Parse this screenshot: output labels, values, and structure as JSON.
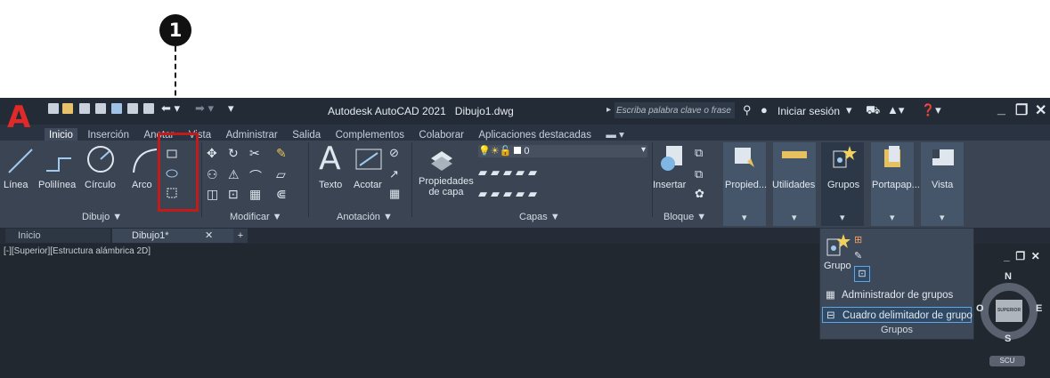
{
  "annotation": {
    "callout_number": "1",
    "highlight_color": "#c21b1b"
  },
  "titlebar": {
    "title": "Autodesk AutoCAD 2021",
    "document": "Dibujo1.dwg",
    "search_placeholder": "Escriba palabra clave o frase",
    "signin": "Iniciar sesión",
    "logo_letter": "A",
    "logo_color": "#e02a2a",
    "icons": [
      "new-icon",
      "open-icon",
      "save-icon",
      "saveas-icon",
      "web-icon",
      "plot-icon",
      "print-icon",
      "undo-icon",
      "redo-icon",
      "search-icon",
      "user-icon",
      "cart-icon",
      "autodesk-icon",
      "help-icon"
    ]
  },
  "ribbon_tabs": [
    "Inicio",
    "Inserción",
    "Anotar",
    "Vista",
    "Administrar",
    "Salida",
    "Complementos",
    "Colaborar",
    "Aplicaciones destacadas"
  ],
  "active_tab": "Inicio",
  "ribbon": {
    "dibujo": {
      "label": "Dibujo ▼",
      "buttons": [
        "Línea",
        "Polilínea",
        "Círculo",
        "Arco"
      ]
    },
    "modificar": {
      "label": "Modificar ▼"
    },
    "anotacion": {
      "label": "Anotación ▼",
      "buttons": [
        "Texto",
        "Acotar"
      ]
    },
    "capas": {
      "label": "Capas ▼",
      "button_line1": "Propiedades",
      "button_line2": "de capa",
      "layer_value": "0"
    },
    "bloque": {
      "label": "Bloque ▼",
      "button": "Insertar"
    },
    "collapsed": [
      "Propied...",
      "Utilidades",
      "Grupos",
      "Portapap...",
      "Vista"
    ]
  },
  "doc_tabs": [
    "Inicio",
    "Dibujo1*"
  ],
  "viewport_label": "[-][Superior][Estructura alámbrica 2D]",
  "groups_menu": {
    "grupo": "Grupo",
    "items": [
      "Administrador de grupos",
      "Cuadro delimitador de grupo"
    ],
    "footer": "Grupos"
  },
  "viewcube": {
    "face": "SUPERIOR",
    "n": "N",
    "s": "S",
    "e": "E",
    "w": "O",
    "ucs": "SCU"
  }
}
